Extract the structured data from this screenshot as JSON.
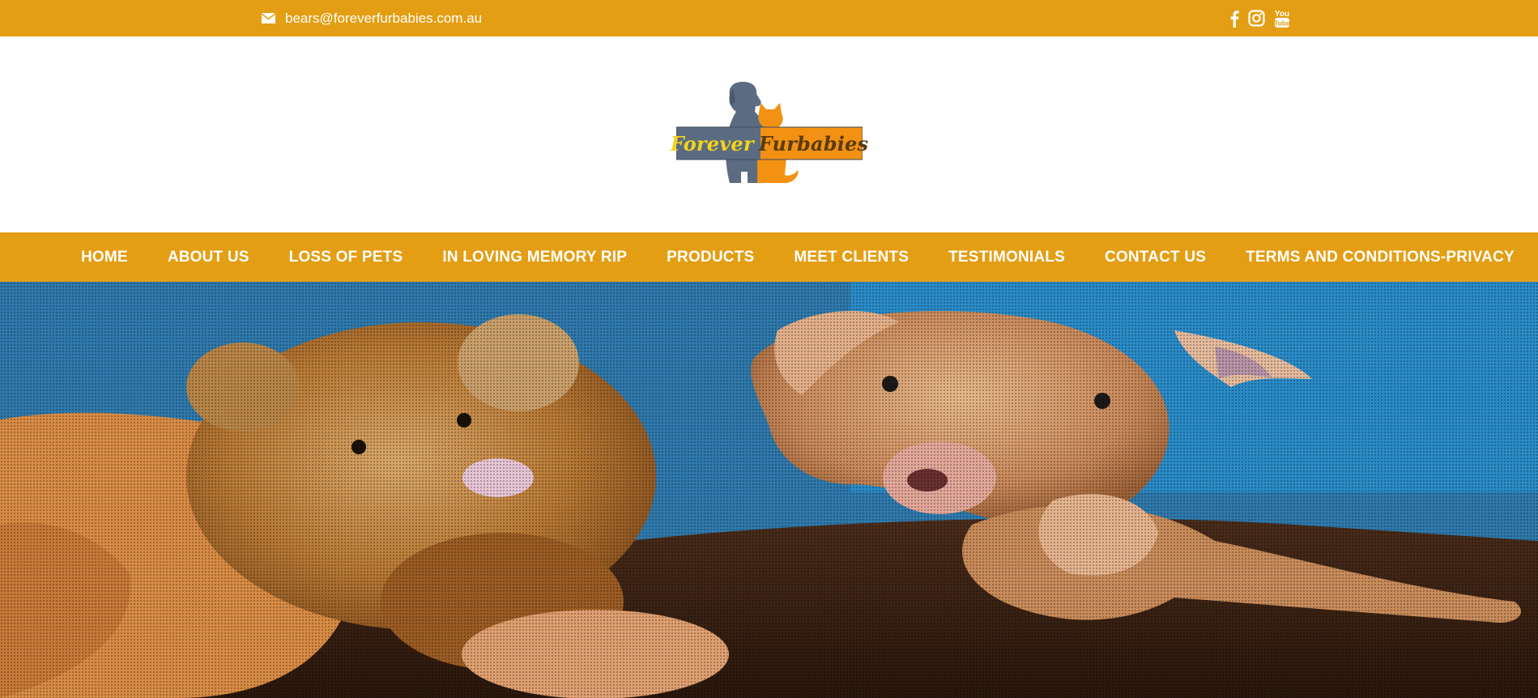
{
  "topbar": {
    "email": "bears@foreverfurbabies.com.au",
    "email_icon": "envelope-icon",
    "social": [
      {
        "name": "facebook-icon"
      },
      {
        "name": "instagram-icon"
      },
      {
        "name": "youtube-icon",
        "label": "You Tube"
      }
    ]
  },
  "logo": {
    "word1": "Forever",
    "word2": "Furbabies",
    "colors": {
      "dog": "#5b6b82",
      "cat": "#f29112",
      "yellow": "#f4d417",
      "banner": "#5b6b82"
    }
  },
  "nav": {
    "items": [
      {
        "label": "HOME"
      },
      {
        "label": "ABOUT US"
      },
      {
        "label": "LOSS OF PETS"
      },
      {
        "label": "IN LOVING MEMORY RIP"
      },
      {
        "label": "PRODUCTS"
      },
      {
        "label": "MEET CLIENTS"
      },
      {
        "label": "TESTIMONIALS"
      },
      {
        "label": "CONTACT US"
      },
      {
        "label": "TERMS AND CONDITIONS-PRIVACY"
      }
    ],
    "cart_icon": "cart-icon"
  },
  "theme": {
    "accent": "#e49e13",
    "text_on_accent": "#ffffff"
  },
  "hero": {
    "image": "dog-with-teddy-bear-photo"
  }
}
